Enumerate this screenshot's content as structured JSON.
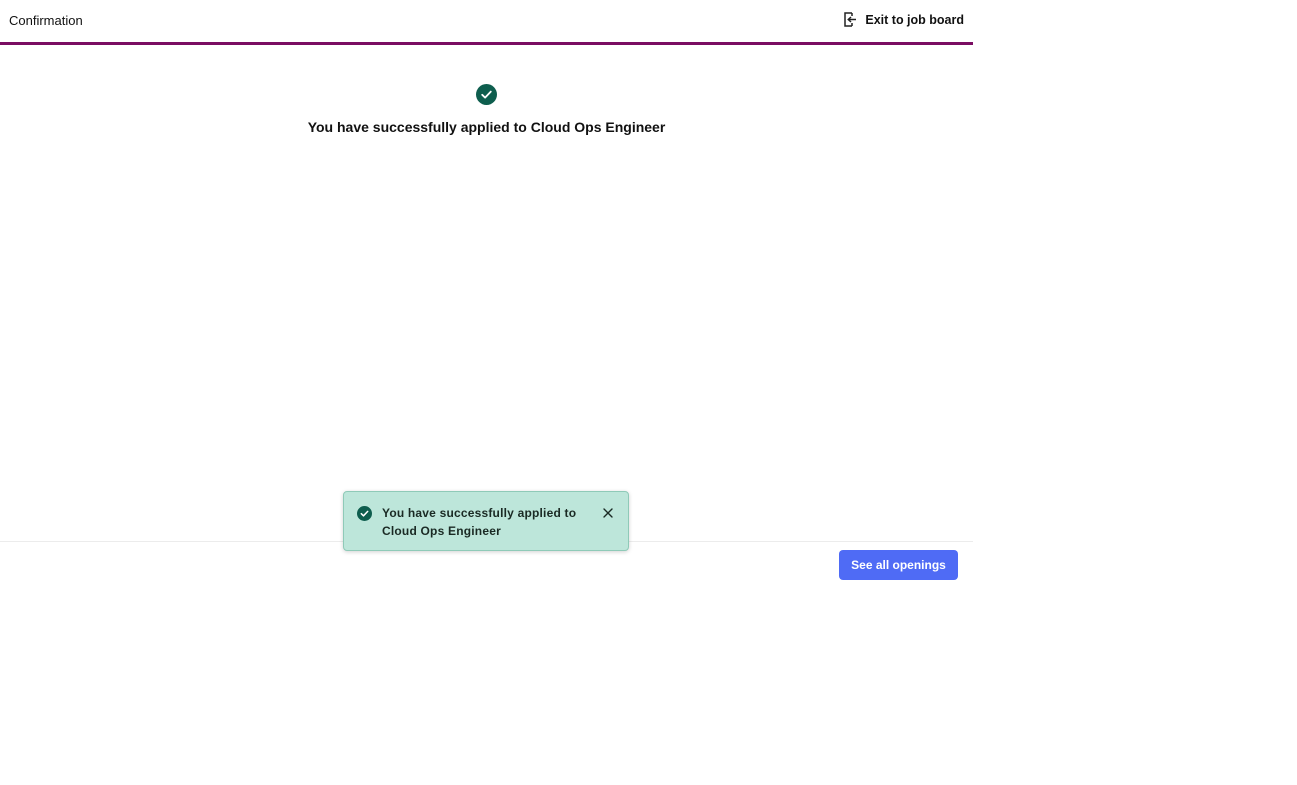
{
  "header": {
    "title": "Confirmation",
    "exit_label": "Exit to job board",
    "exit_icon": "exit-door-icon",
    "accent_color": "#7a0d62"
  },
  "confirmation": {
    "icon": "check-circle-icon",
    "message": "You have successfully applied to Cloud Ops Engineer",
    "icon_color": "#0e5e4e"
  },
  "footer": {
    "see_all_label": "See all openings",
    "button_color": "#4f6bf5"
  },
  "toast": {
    "icon": "check-circle-icon",
    "message": "You have successfully applied to Cloud Ops Engineer",
    "close_icon": "close-icon",
    "background": "#bde6da"
  }
}
